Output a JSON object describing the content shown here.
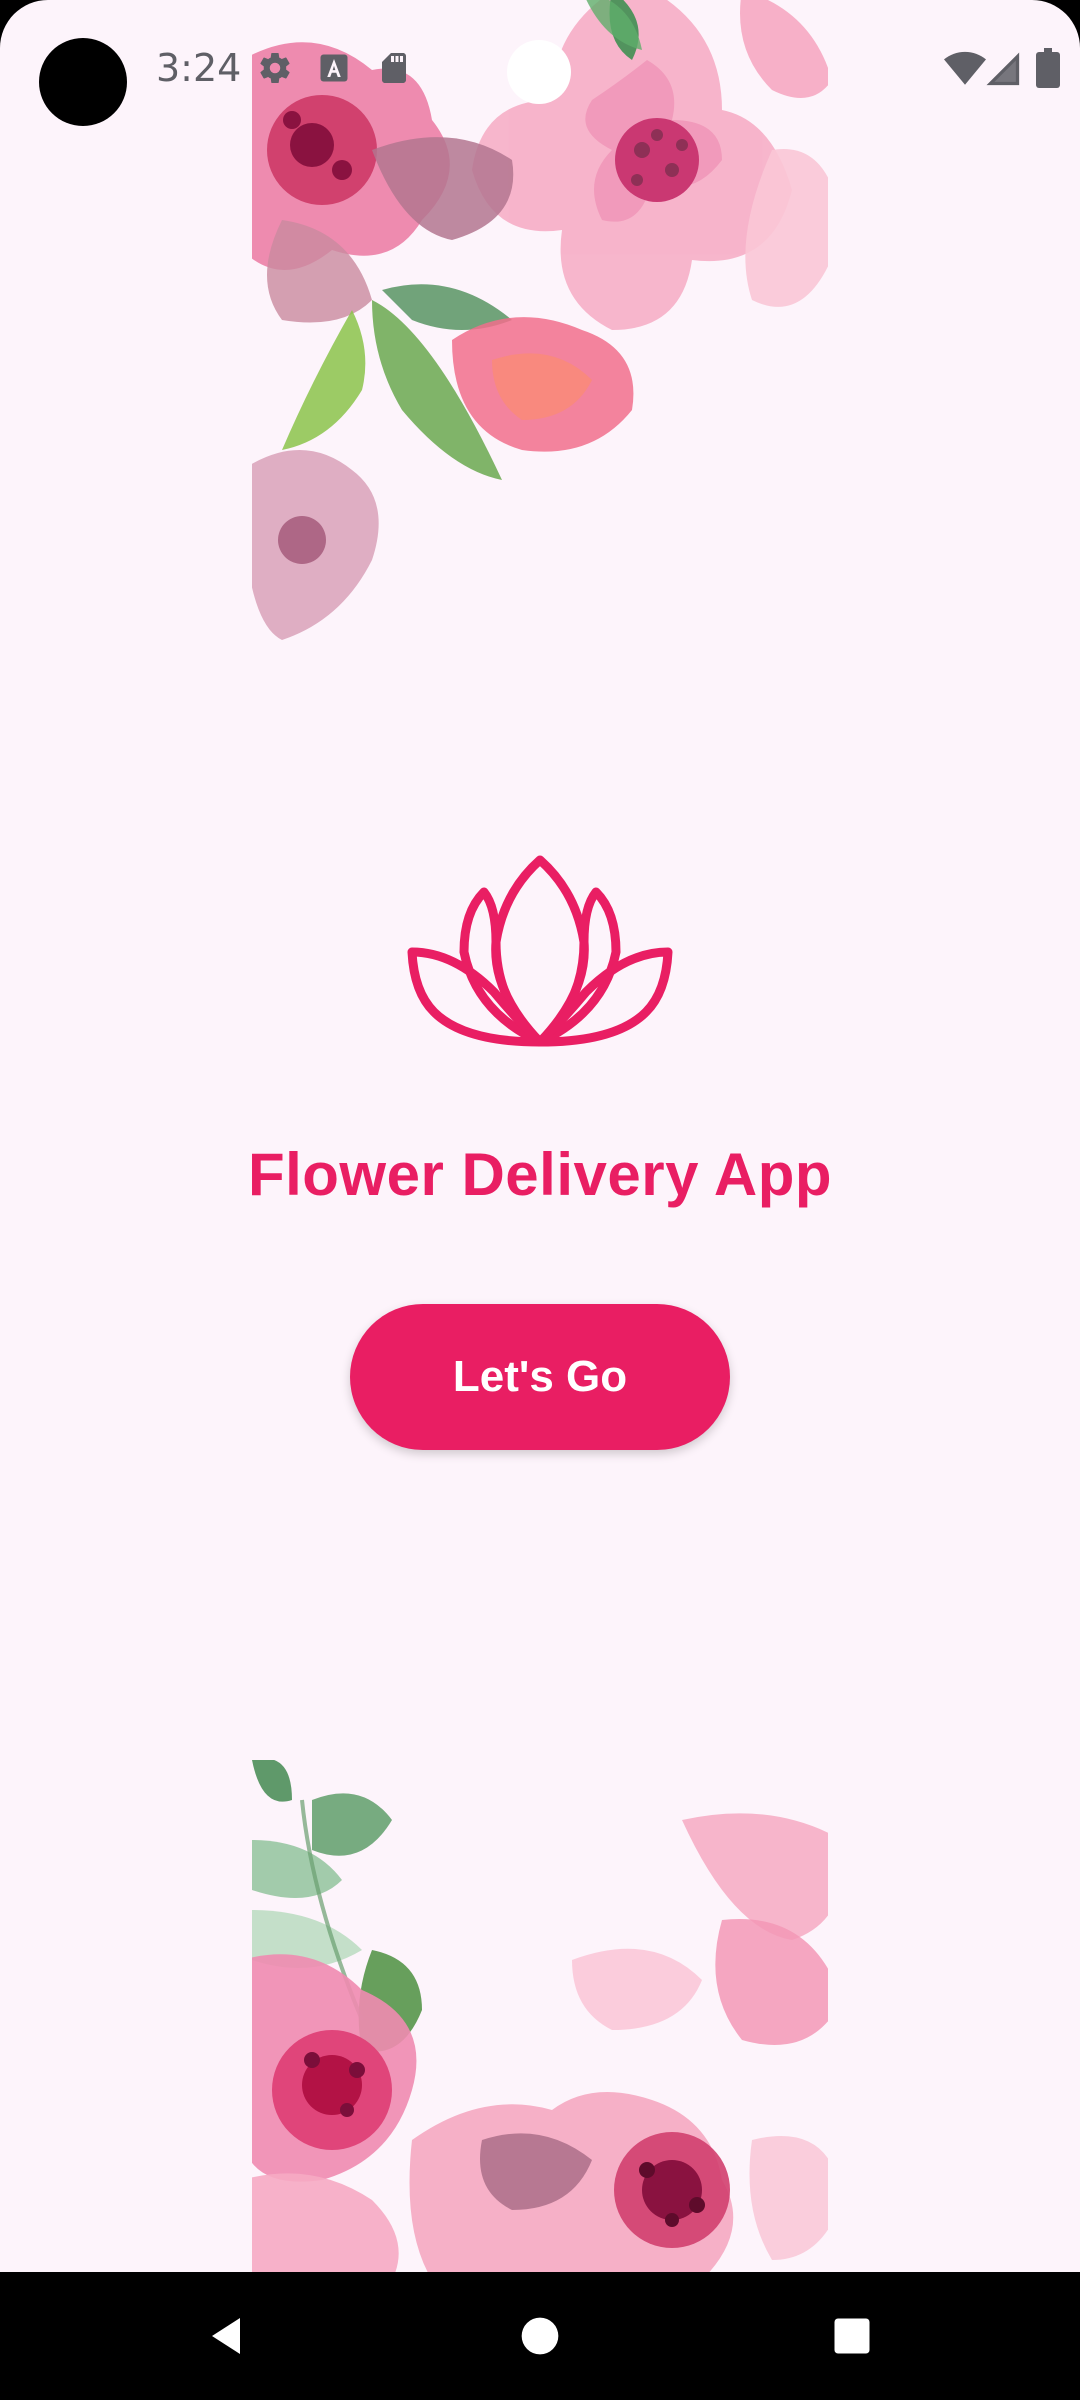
{
  "status_bar": {
    "time": "3:24",
    "left_icons": [
      "gear-icon",
      "font-a-icon",
      "sd-card-icon"
    ],
    "right_icons": [
      "wifi-icon",
      "cell-signal-icon",
      "battery-icon"
    ]
  },
  "decorations": {
    "top": "watercolor-flowers",
    "bottom": "watercolor-flowers"
  },
  "logo": {
    "icon": "lotus-icon"
  },
  "app_title": "Flower Delivery App",
  "cta_button": {
    "label": "Let's Go"
  },
  "nav_bar": {
    "back": "back-triangle-icon",
    "home": "home-circle-icon",
    "recents": "recents-square-icon"
  },
  "colors": {
    "accent": "#e91e63",
    "background": "#fdf4fb",
    "nav_bar": "#000000"
  }
}
